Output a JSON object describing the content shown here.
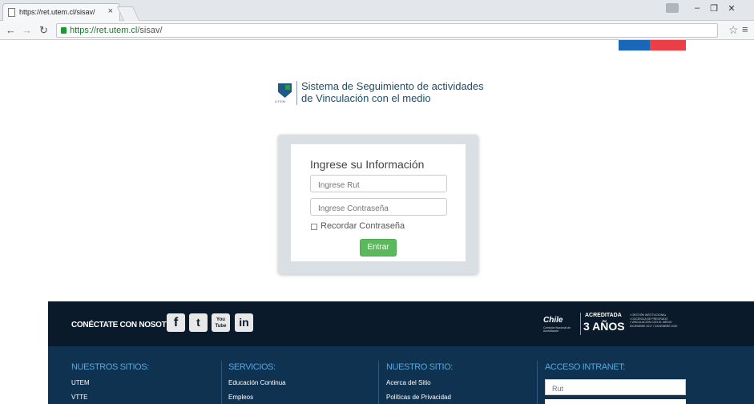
{
  "browser": {
    "tab_title": "https://ret.utem.cl/sisav/",
    "tab_close": "×",
    "url_host": "https://ret.utem.cl",
    "url_path": "/sisav/",
    "icons": [
      "page-icon",
      "close-icon",
      "back-icon",
      "forward-icon",
      "reload-icon",
      "lock-icon",
      "star-icon",
      "menu-icon",
      "minimize-icon",
      "restore-icon",
      "window-close-icon"
    ]
  },
  "header": {
    "logo_text": "UTEM",
    "title_line1": "Sistema de Seguimiento de actividades",
    "title_line2": "de Vinculación con el medio",
    "flag_colors": [
      "#1b67b7",
      "#ee3e45"
    ]
  },
  "login": {
    "title": "Ingrese su Información",
    "rut_placeholder": "Ingrese Rut",
    "password_placeholder": "Ingrese Contraseña",
    "remember_label": "Recordar Contraseña",
    "submit_label": "Entrar",
    "accent": "#5cb85c"
  },
  "footer": {
    "connect_label": "CONÉCTATE CON NOSOTROS:",
    "social": [
      "f",
      "t",
      "You Tube",
      "in"
    ],
    "accreditation": {
      "brand": "Chile",
      "brand_sub": "Comisión Nacional de Acreditación",
      "label": "ACREDITADA",
      "years": "3 AÑOS",
      "areas": [
        "• GESTIÓN INSTITUCIONAL",
        "• DOCENCIA DE PREGRADO",
        "• VINCULACIÓN CON EL MEDIO",
        "DICIEMBRE 2017 / DICIEMBRE 2020"
      ]
    },
    "columns": [
      {
        "title": "NUESTROS SITIOS:",
        "links": [
          "UTEM",
          "VTTE"
        ]
      },
      {
        "title": "SERVICIOS:",
        "links": [
          "Educación Continua",
          "Empleos"
        ]
      },
      {
        "title": "NUESTRO SITIO:",
        "links": [
          "Acerca del Sitio",
          "Políticas de Privacidad"
        ]
      },
      {
        "title": "ACCESO INTRANET:",
        "rut_placeholder": "Rut"
      }
    ]
  }
}
